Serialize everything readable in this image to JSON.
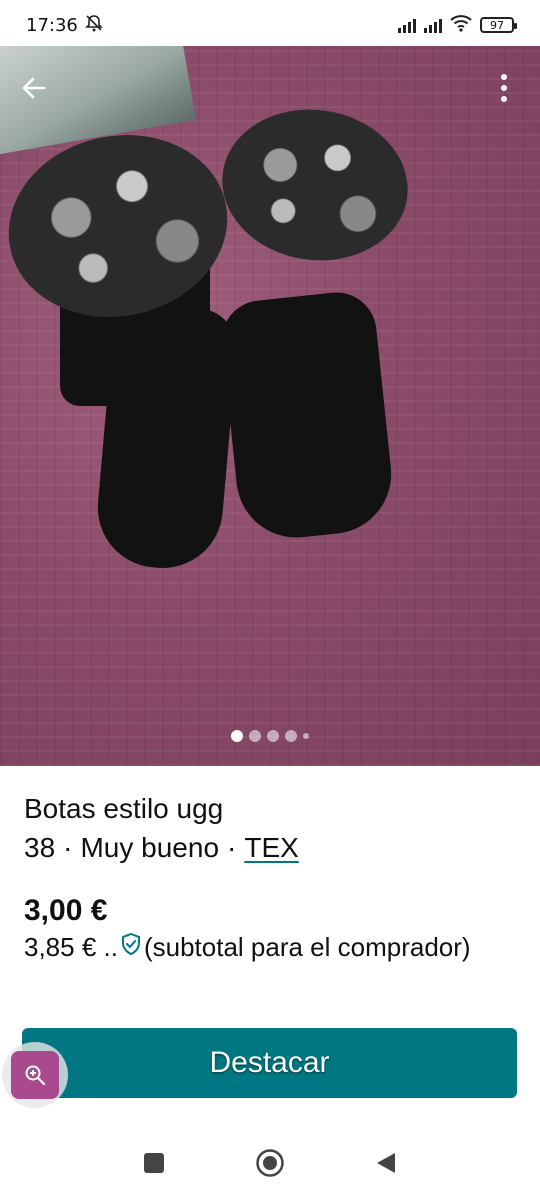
{
  "status_bar": {
    "time": "17:36",
    "battery": "97"
  },
  "photo": {
    "dots_count": 5,
    "active_dot": 0
  },
  "listing": {
    "title": "Botas estilo ugg",
    "size": "38",
    "sep1": "·",
    "condition": "Muy bueno",
    "sep2": "·",
    "brand": "TEX",
    "price": "3,00 €",
    "buyer_price": "3,85 € ..",
    "buyer_note": "(subtotal para el comprador)"
  },
  "actions": {
    "destacar_label": "Destacar"
  },
  "colors": {
    "accent": "#007782",
    "zoom_fab": "#a84a8d"
  },
  "icons": {
    "back": "arrow-back-icon",
    "more": "more-vert-icon",
    "shield": "shield-check-icon",
    "zoom": "zoom-in-icon"
  }
}
